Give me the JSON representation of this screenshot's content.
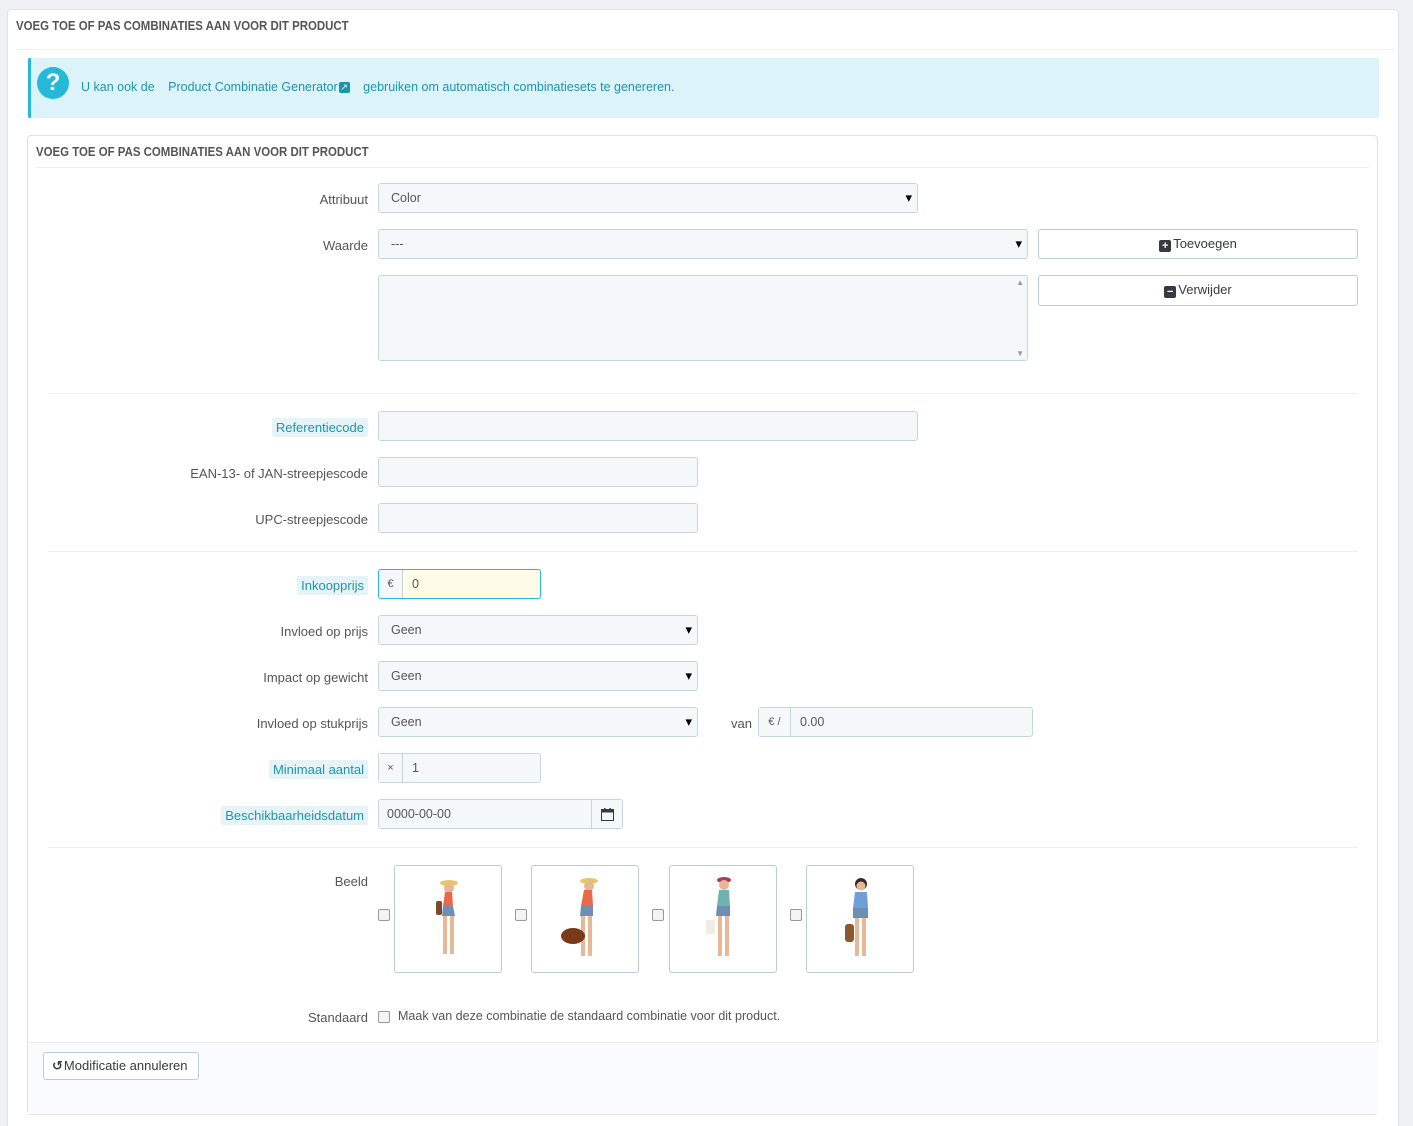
{
  "outer": {
    "title": "VOEG TOE OF PAS COMBINATIES AAN VOOR DIT PRODUCT"
  },
  "info": {
    "icon": "question-icon",
    "prefix": "U kan ook de",
    "link": "Product Combinatie Generator",
    "suffix": "gebruiken om automatisch combinatiesets te genereren."
  },
  "panel": {
    "title": "VOEG TOE OF PAS COMBINATIES AAN VOOR DIT PRODUCT"
  },
  "form": {
    "attribute_label": "Attribuut",
    "attribute_value": "Color",
    "value_label": "Waarde",
    "value_value": "---",
    "add_button": "Toevoegen",
    "remove_button": "Verwijder",
    "reference_label": "Referentiecode",
    "reference_value": "",
    "ean_label": "EAN-13- of JAN-streepjescode",
    "ean_value": "",
    "upc_label": "UPC-streepjescode",
    "upc_value": "",
    "wholesale_label": "Inkoopprijs",
    "currency": "€",
    "wholesale_value": "0",
    "price_impact_label": "Invloed op prijs",
    "price_impact_value": "Geen",
    "weight_impact_label": "Impact op gewicht",
    "weight_impact_value": "Geen",
    "unit_impact_label": "Invloed op stukprijs",
    "unit_impact_value": "Geen",
    "van_label": "van",
    "unit_currency": "€ /",
    "unit_value": "0.00",
    "min_qty_label": "Minimaal aantal",
    "min_qty_prefix": "×",
    "min_qty_value": "1",
    "avail_label": "Beschikbaarheidsdatum",
    "avail_value": "0000-00-00",
    "image_label": "Beeld",
    "images": [
      {
        "name": "model-orange-top-hat-bag",
        "selected": false
      },
      {
        "name": "model-orange-top-brown-bag",
        "selected": false
      },
      {
        "name": "model-teal-top-white-bag",
        "selected": false
      },
      {
        "name": "model-blue-top-brown-bag",
        "selected": false
      }
    ],
    "default_label": "Standaard",
    "default_text": "Maak van deze combinatie de standaard combinatie voor dit product."
  },
  "footer": {
    "cancel_button": "Modificatie annuleren"
  },
  "colors": {
    "accent": "#25b9d7",
    "info_bg": "#dcf4f9",
    "hint_bg": "#e6f4f8",
    "hint_text": "#1e94ab",
    "focus_bg": "#fefbe6"
  }
}
